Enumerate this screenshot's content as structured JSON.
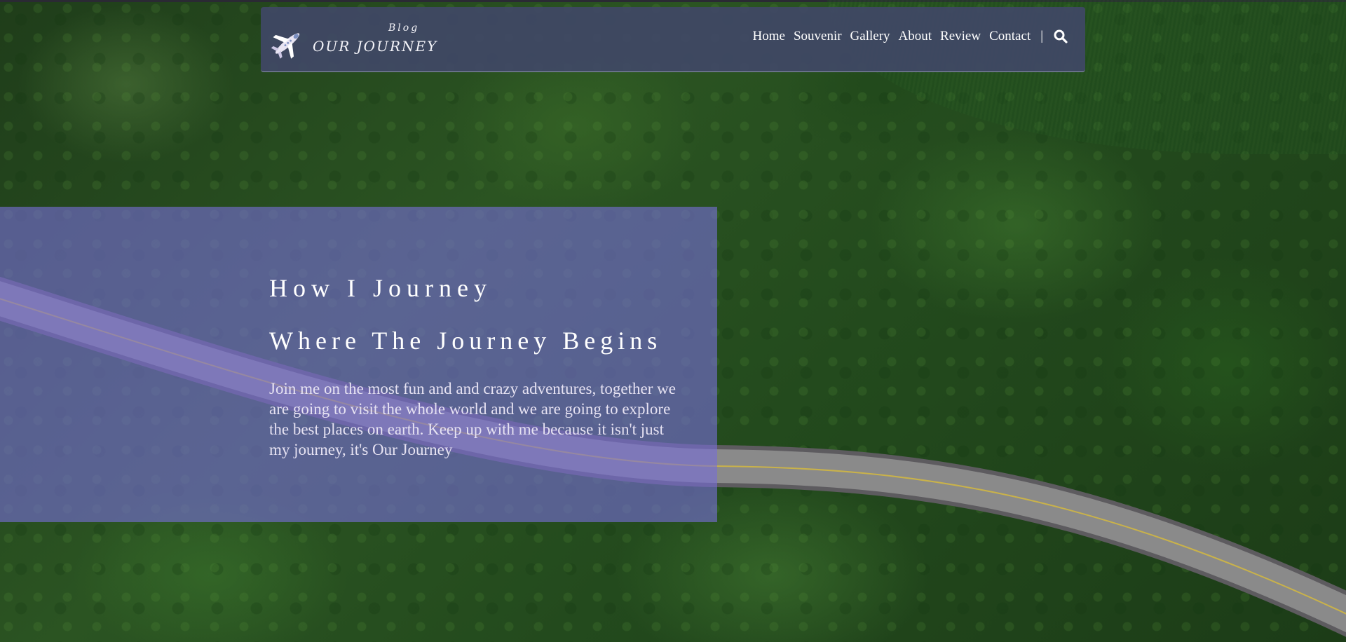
{
  "brand": {
    "tag": "Blog",
    "name": "OUR JOURNEY",
    "icon": "airplane-icon"
  },
  "nav": {
    "items": [
      "Home",
      "Souvenir",
      "Gallery",
      "About",
      "Review",
      "Contact"
    ],
    "separator": "|",
    "search_icon": "search-icon"
  },
  "hero": {
    "title": "How I Journey",
    "subtitle": "Where The Journey Begins",
    "text": "Join me on the most fun and and crazy adventures, together we are going to visit the whole world and we are going to explore the best places on earth. Keep up with me because it isn't just my journey, it's Our Journey"
  },
  "colors": {
    "navbar": "#404866",
    "hero_panel": "#786ed7",
    "foliage": "#2b5422",
    "road": "#6f6e70"
  }
}
